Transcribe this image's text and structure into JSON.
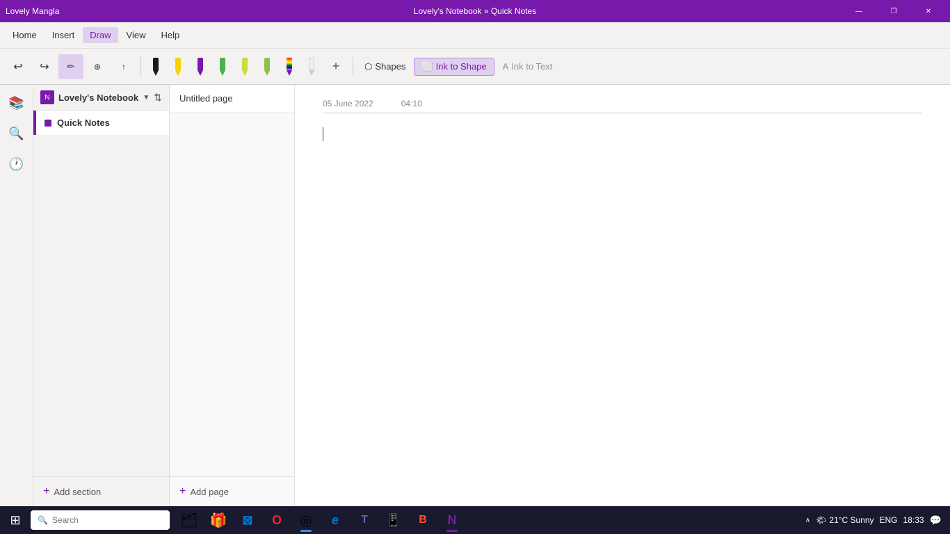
{
  "titlebar": {
    "title": "Lovely's Notebook » Quick Notes",
    "user": "Lovely Mangla",
    "separator": "|",
    "minimize": "—",
    "maximize": "❐",
    "close": "✕"
  },
  "menubar": {
    "items": [
      {
        "label": "Home",
        "active": false
      },
      {
        "label": "Insert",
        "active": false
      },
      {
        "label": "Draw",
        "active": true
      },
      {
        "label": "View",
        "active": false
      },
      {
        "label": "Help",
        "active": false
      }
    ]
  },
  "toolbar": {
    "undo_label": "Undo",
    "redo_label": "Redo",
    "lasso_label": "Lasso Select",
    "eraser_label": "Eraser",
    "add_label": "Add",
    "shapes_label": "Shapes",
    "ink_to_shape_label": "Ink to Shape",
    "ink_to_text_label": "Ink to Text",
    "pens": [
      {
        "color": "#1a1a1a",
        "name": "black-pen"
      },
      {
        "color": "#f5d100",
        "name": "yellow-pen"
      },
      {
        "color": "#7719aa",
        "name": "purple-pen"
      },
      {
        "color": "#4caf50",
        "name": "green-pen"
      },
      {
        "color": "#cddc39",
        "name": "lime-pen"
      },
      {
        "color": "#8bc34a",
        "name": "olive-pen"
      },
      {
        "color": "rainbow",
        "name": "rainbow-pen"
      },
      {
        "color": "#f0f0f0",
        "name": "white-pen"
      }
    ]
  },
  "sidebar": {
    "notebook_name": "Lovely's Notebook",
    "sections": [
      {
        "label": "Quick Notes",
        "active": true,
        "color": "#7719aa"
      }
    ],
    "add_section_label": "Add section"
  },
  "pages": {
    "items": [
      {
        "label": "Untitled page",
        "active": true
      }
    ],
    "add_page_label": "Add page"
  },
  "content": {
    "date": "05 June 2022",
    "time": "04:10"
  },
  "taskbar": {
    "search_placeholder": "Search",
    "apps": [
      {
        "name": "windows",
        "icon": "⊞",
        "indicator_color": ""
      },
      {
        "name": "windows-explorer",
        "icon": "📁",
        "indicator_color": ""
      },
      {
        "name": "ms-store",
        "icon": "🛍",
        "indicator_color": ""
      },
      {
        "name": "opera",
        "icon": "O",
        "indicator_color": ""
      },
      {
        "name": "chrome",
        "icon": "◎",
        "indicator_color": "#4285f4"
      },
      {
        "name": "edge",
        "icon": "e",
        "indicator_color": ""
      },
      {
        "name": "teams",
        "icon": "T",
        "indicator_color": ""
      },
      {
        "name": "whatsapp",
        "icon": "W",
        "indicator_color": ""
      },
      {
        "name": "brave",
        "icon": "B",
        "indicator_color": ""
      },
      {
        "name": "onenote",
        "icon": "N",
        "indicator_color": "#7719aa"
      }
    ],
    "weather": "21°C  Sunny",
    "language": "ENG",
    "time": "18:33"
  }
}
